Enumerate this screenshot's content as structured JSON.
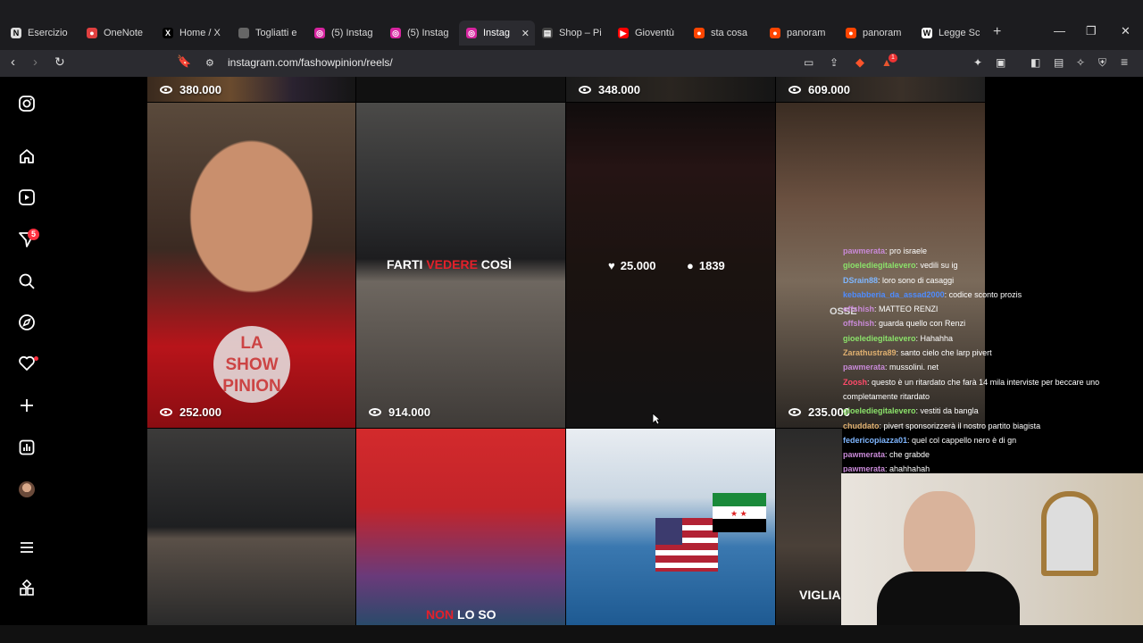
{
  "browser": {
    "tabs": [
      {
        "label": "Esercizio",
        "icon": "notion-icon",
        "active": false
      },
      {
        "label": "OneNote",
        "icon": "record-icon",
        "active": false
      },
      {
        "label": "Home / X",
        "icon": "x-logo-icon",
        "active": false
      },
      {
        "label": "Togliatti e",
        "icon": "page-icon",
        "active": false
      },
      {
        "label": "(5) Instag",
        "icon": "instagram-icon",
        "active": false
      },
      {
        "label": "(5) Instag",
        "icon": "instagram-icon",
        "active": false
      },
      {
        "label": "Instag",
        "icon": "instagram-icon",
        "active": true
      },
      {
        "label": "Shop – Pi",
        "icon": "shop-icon",
        "active": false
      },
      {
        "label": "Gioventù",
        "icon": "youtube-icon",
        "active": false
      },
      {
        "label": "sta cosa",
        "icon": "reddit-icon",
        "active": false
      },
      {
        "label": "panoram",
        "icon": "reddit-icon",
        "active": false
      },
      {
        "label": "panoram",
        "icon": "reddit-icon",
        "active": false
      },
      {
        "label": "Legge Sc",
        "icon": "wikipedia-icon",
        "active": false
      }
    ],
    "url": "instagram.com/fashowpinion/reels/",
    "brave_badge": "1"
  },
  "sidebar": {
    "notification_count": "5"
  },
  "reels": {
    "top_row_views": [
      "380.000",
      "348.000",
      "609.000"
    ],
    "grid": [
      {
        "views": "252.000",
        "logo_text": "LA SHOW PINION"
      },
      {
        "views": "914.000",
        "caption_white": "FARTI ",
        "caption_red": "VEDERE",
        "caption_tail": " COSÌ"
      },
      {
        "likes": "25.000",
        "comments": "1839"
      },
      {
        "views": "235.000",
        "overlay_text": "OSSE"
      }
    ],
    "bottom_row": [
      {
        "caption": ""
      },
      {
        "caption_red": "NON",
        "caption_white": " LO SO"
      },
      {
        "caption": ""
      },
      {
        "caption": "VIGLIA"
      }
    ]
  },
  "chat": [
    {
      "user": "pawmerata",
      "text": ": pro israele",
      "color": "#c98ad8"
    },
    {
      "user": "gioelediegitalevero",
      "text": ": vedili su ig",
      "color": "#8be26a"
    },
    {
      "user": "DSrain88",
      "text": ": loro sono di casaggi",
      "color": "#7fb6ff"
    },
    {
      "user": "kebabberia_da_assad2000",
      "text": ": codice sconto prozis",
      "color": "#4e8cff"
    },
    {
      "user": "offshish",
      "text": ": MATTEO RENZI",
      "color": "#c98ad8"
    },
    {
      "user": "offshish",
      "text": ": guarda quello con Renzi",
      "color": "#c98ad8"
    },
    {
      "user": "gioelediegitalevero",
      "text": ": Hahahha",
      "color": "#8be26a"
    },
    {
      "user": "Zarathustra89",
      "text": ": santo cielo che larp pivert",
      "color": "#e0b070"
    },
    {
      "user": "pawmerata",
      "text": ": mussolini. net",
      "color": "#c98ad8"
    },
    {
      "user": "Zoosh",
      "text": ": questo è un ritardato che farà 14 mila interviste per beccare uno",
      "color": "#ff4a6a"
    },
    {
      "user": "",
      "text": "completamente ritardato",
      "color": "#ffffff"
    },
    {
      "user": "gioelediegitalevero",
      "text": ": vestiti da bangla",
      "color": "#8be26a"
    },
    {
      "user": "chuddato",
      "text": ": pivert sponsorizzerà il nostro partito biagista",
      "color": "#e0b070"
    },
    {
      "user": "federicopiazza01",
      "text": ": quel col cappello nero è di gn",
      "color": "#7fb6ff"
    },
    {
      "user": "pawmerata",
      "text": ": che grabde",
      "color": "#c98ad8"
    },
    {
      "user": "pawmerata",
      "text": ": ahahhahah",
      "color": "#c98ad8"
    }
  ]
}
